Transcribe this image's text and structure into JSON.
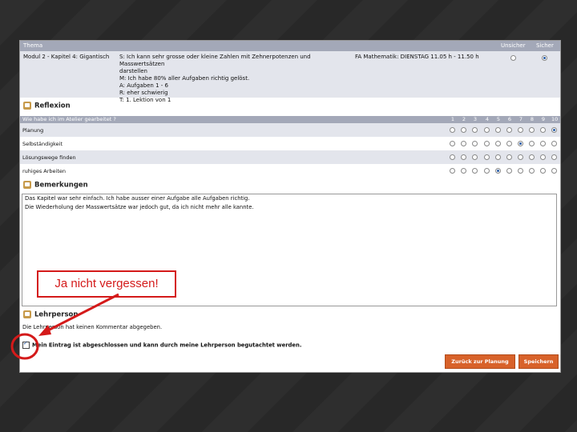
{
  "header": {
    "col_thema": "Thema",
    "col_unsicher": "Unsicher",
    "col_sicher": "Sicher"
  },
  "topic_row": {
    "modul": "Modul 2 - Kapitel 4: Gigantisch",
    "goal_lines": [
      "S: Ich kann sehr grosse oder kleine Zahlen mit Zehnerpotenzen und Masswertsätzen",
      "darstellen",
      "M: Ich habe 80% aller Aufgaben richtig gelöst.",
      "A: Aufgaben 1 - 6",
      "R: eher schwierig",
      "T: 1. Lektion von 1"
    ],
    "lesson": "FA Mathematik: DIENSTAG 11.05 h - 11.50 h",
    "selected": "sicher"
  },
  "reflexion": {
    "title": "Reflexion",
    "question": "Wie habe ich im Atelier gearbeitet ?",
    "scale": [
      "1",
      "2",
      "3",
      "4",
      "5",
      "6",
      "7",
      "8",
      "9",
      "10"
    ],
    "rows": [
      {
        "label": "Planung",
        "value": 10
      },
      {
        "label": "Selbständigkeit",
        "value": 7
      },
      {
        "label": "Lösungswege finden",
        "value": null
      },
      {
        "label": "ruhiges Arbeiten",
        "value": 5
      }
    ]
  },
  "bemerkungen": {
    "title": "Bemerkungen",
    "lines": [
      "Das Kapitel war sehr einfach. Ich habe ausser einer Aufgabe alle Aufgaben richtig.",
      "Die Wiederholung der Masswertsätze war jedoch gut, da ich nicht mehr alle kannte."
    ]
  },
  "lehrperson": {
    "title": "Lehrperson",
    "text": "Die Lehrperson hat keinen Kommentar abgegeben."
  },
  "confirm": {
    "label": "Mein Eintrag ist abgeschlossen und kann durch meine Lehrperson begutachtet werden.",
    "checked": true
  },
  "buttons": {
    "back": "Zurück zur Planung",
    "save": "Speichern"
  },
  "annotation": {
    "callout": "Ja nicht vergessen!"
  },
  "colors": {
    "accent_button": "#d8622a",
    "header_bar": "#a3a8b8",
    "annotation_red": "#d41a1a"
  }
}
